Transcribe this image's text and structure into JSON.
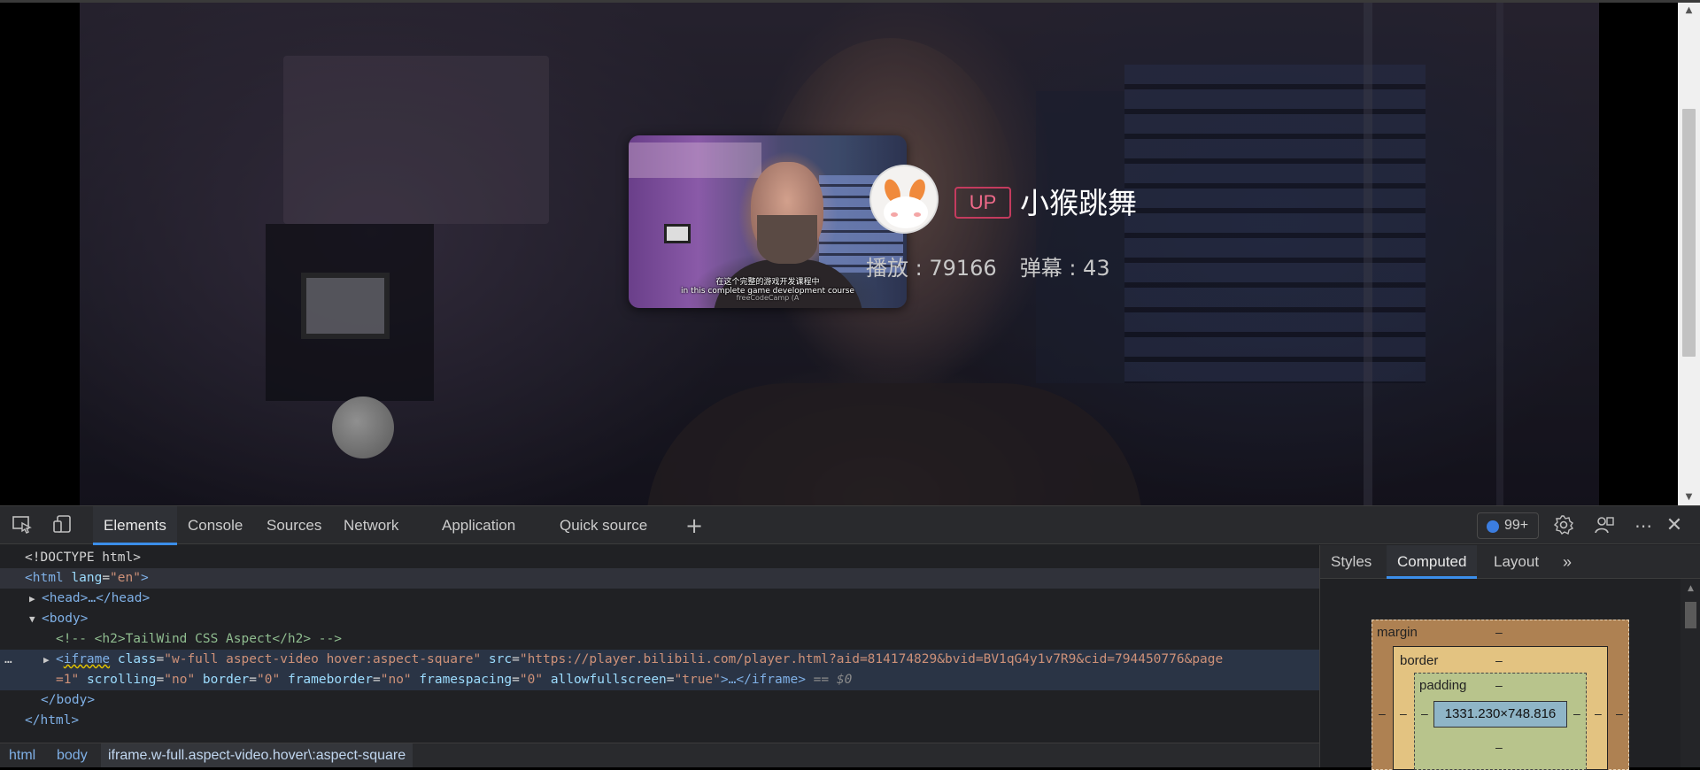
{
  "video_card": {
    "subtitle_cn": "在这个完整的游戏开发课程中",
    "subtitle_en": "in this complete game development course",
    "subtitle_trail": "freeCodeCamp (A"
  },
  "uploader": {
    "badge": "UP",
    "name": "小猴跳舞",
    "plays_label": "播放 : 79166",
    "danmaku_label": "弹幕 : 43"
  },
  "devtools": {
    "tabs": [
      "Elements",
      "Console",
      "Sources",
      "Network",
      "Application",
      "Quick source"
    ],
    "active_tab": "Elements",
    "issues_badge": "99+",
    "dom": {
      "line1": "<!DOCTYPE html>",
      "html_open_tag": "<html",
      "html_attr": "lang",
      "html_attr_val": "\"en\"",
      "head": "<head>…</head>",
      "body_open": "<body>",
      "comment": "<!-- <h2>TailWind CSS Aspect</h2> -->",
      "iframe_tag": "iframe",
      "iframe_class_attr": "class",
      "iframe_class_val": "\"w-full aspect-video hover:aspect-square\"",
      "iframe_src_attr": "src",
      "iframe_src_val": "\"https://player.bilibili.com/player.html?aid=814174829&bvid=BV1qG4y1v7R9&cid=794450776&page",
      "iframe_src_cont": "=1\"",
      "iframe_scrolling": "scrolling",
      "iframe_scrolling_val": "\"no\"",
      "iframe_border": "border",
      "iframe_border_val": "\"0\"",
      "iframe_frameborder": "frameborder",
      "iframe_frameborder_val": "\"no\"",
      "iframe_framespacing": "framespacing",
      "iframe_framespacing_val": "\"0\"",
      "iframe_allowfullscreen": "allowfullscreen",
      "iframe_allowfullscreen_val": "\"true\"",
      "iframe_close": ">…</iframe>",
      "dollar_ref": "== $0",
      "body_close": "</body>",
      "html_close": "</html>"
    },
    "breadcrumbs": [
      "html",
      "body",
      "iframe.w-full.aspect-video.hover\\:aspect-square"
    ],
    "side_tabs": [
      "Styles",
      "Computed",
      "Layout"
    ],
    "active_side_tab": "Computed",
    "box_model": {
      "margin_label": "margin",
      "border_label": "border",
      "padding_label": "padding",
      "dash": "–",
      "content_size": "1331.230×748.816"
    }
  },
  "colors": {
    "accent": "#3b8eea",
    "up_badge": "#c43b5e"
  }
}
